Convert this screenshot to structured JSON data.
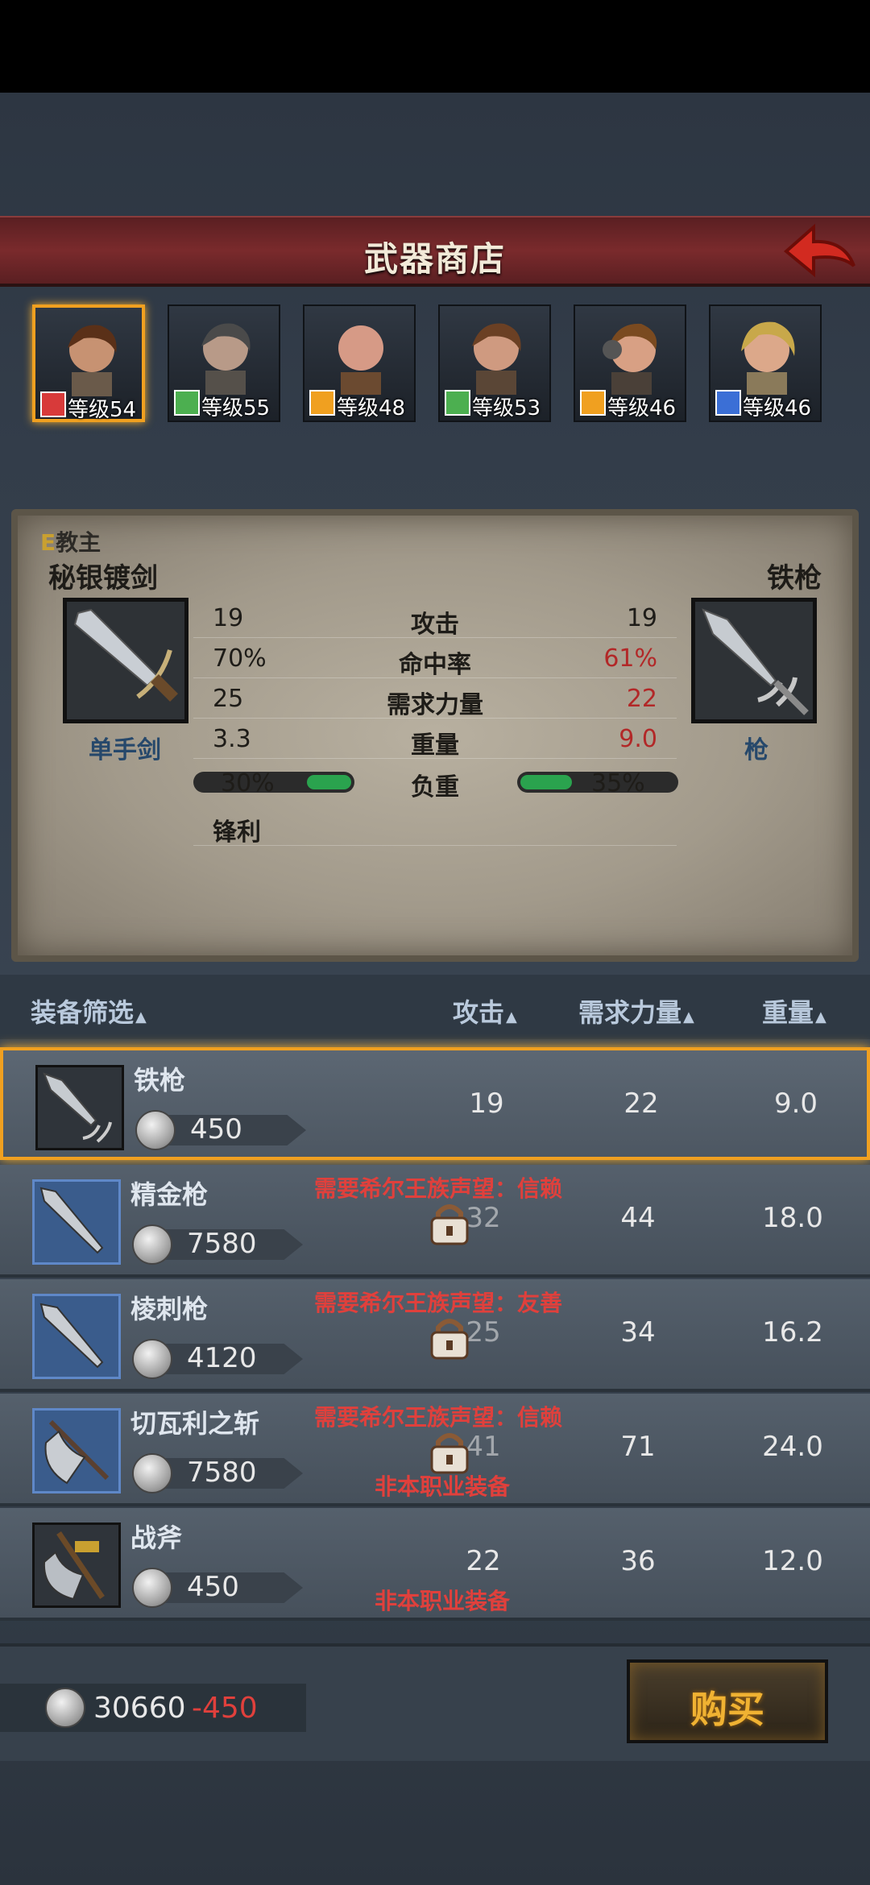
{
  "header": {
    "title": "武器商店"
  },
  "heroes": [
    {
      "level": "等级54",
      "class_icon": "horse-class-icon",
      "class_color": "#d83a3a",
      "selected": true
    },
    {
      "level": "等级55",
      "class_icon": "cross-swords-class-icon",
      "class_color": "#4caf50"
    },
    {
      "level": "等级48",
      "class_icon": "shield-class-icon",
      "class_color": "#f0a020"
    },
    {
      "level": "等级53",
      "class_icon": "cross-swords-class-icon",
      "class_color": "#4caf50"
    },
    {
      "level": "等级46",
      "class_icon": "shield-class-icon",
      "class_color": "#f0a020"
    },
    {
      "level": "等级46",
      "class_icon": "sword-class-icon",
      "class_color": "#3b6fd6"
    }
  ],
  "compare": {
    "grade": "E",
    "hero_title": "教主",
    "left_name": "秘银镀剑",
    "left_type": "单手剑",
    "right_name": "铁枪",
    "right_type": "枪",
    "stats": [
      {
        "label": "攻击",
        "left": "19",
        "right": "19",
        "right_worse": false
      },
      {
        "label": "命中率",
        "left": "70%",
        "right": "61%",
        "right_worse": true
      },
      {
        "label": "需求力量",
        "left": "25",
        "right": "22",
        "right_worse": true
      },
      {
        "label": "重量",
        "left": "3.3",
        "right": "9.0",
        "right_worse": true
      }
    ],
    "load": {
      "label": "负重",
      "left": "30%",
      "right": "35%",
      "left_pct": 0.3,
      "right_pct": 0.35
    },
    "trait": "锋利"
  },
  "list_header": {
    "filter": "装备筛选",
    "attack": "攻击",
    "strength": "需求力量",
    "weight": "重量",
    "arrow": "▲"
  },
  "items": [
    {
      "name": "铁枪",
      "price": "450",
      "attack": "19",
      "strength": "22",
      "weight": "9.0",
      "selected": true
    },
    {
      "name": "精金枪",
      "price": "7580",
      "attack": "32",
      "strength": "44",
      "weight": "18.0",
      "req": "需要希尔王族声望：信赖",
      "locked": true
    },
    {
      "name": "棱刺枪",
      "price": "4120",
      "attack": "25",
      "strength": "34",
      "weight": "16.2",
      "req": "需要希尔王族声望：友善",
      "locked": true
    },
    {
      "name": "切瓦利之斩",
      "price": "7580",
      "attack": "41",
      "strength": "71",
      "weight": "24.0",
      "req": "需要希尔王族声望：信赖",
      "note": "非本职业装备",
      "locked": true
    },
    {
      "name": "战斧",
      "price": "450",
      "attack": "22",
      "strength": "36",
      "weight": "12.0",
      "note": "非本职业装备"
    }
  ],
  "footer": {
    "gold": "30660",
    "delta": "-450",
    "buy": "购买"
  }
}
